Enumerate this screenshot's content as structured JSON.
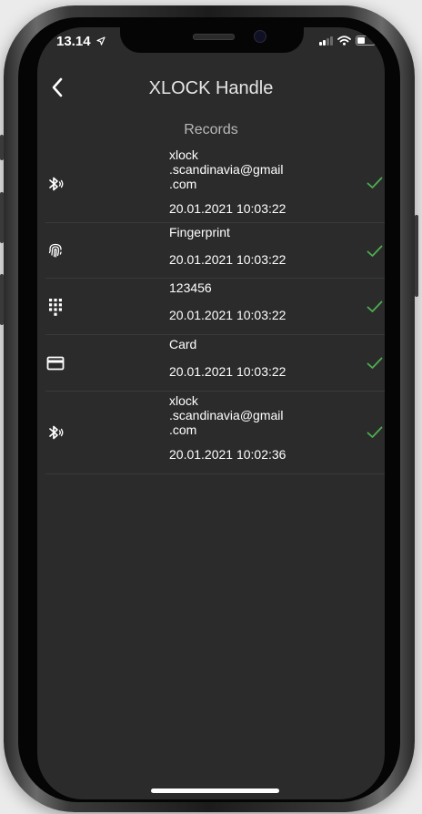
{
  "status_bar": {
    "time": "13.14",
    "location_icon": "location-arrow-icon",
    "signal_icon": "cellular-signal-icon",
    "wifi_icon": "wifi-icon",
    "battery_icon": "battery-icon"
  },
  "nav": {
    "back_icon": "chevron-left-icon",
    "title": "XLOCK Handle"
  },
  "section": {
    "title": "Records"
  },
  "records": [
    {
      "type_icon": "bluetooth-icon",
      "name": "xlock\n.scandinavia@gmail\n.com",
      "time": "20.01.2021 10:03:22",
      "status_icon": "check-icon"
    },
    {
      "type_icon": "fingerprint-icon",
      "name": "Fingerprint",
      "time": "20.01.2021 10:03:22",
      "status_icon": "check-icon"
    },
    {
      "type_icon": "keypad-icon",
      "name": "123456",
      "time": "20.01.2021 10:03:22",
      "status_icon": "check-icon"
    },
    {
      "type_icon": "card-icon",
      "name": "Card",
      "time": "20.01.2021 10:03:22",
      "status_icon": "check-icon"
    },
    {
      "type_icon": "bluetooth-icon",
      "name": "xlock\n.scandinavia@gmail\n.com",
      "time": "20.01.2021 10:02:36",
      "status_icon": "check-icon"
    }
  ],
  "colors": {
    "background": "#2b2b2b",
    "text": "#ffffff",
    "check": "#4caf50",
    "divider": "#3a3a3a"
  }
}
